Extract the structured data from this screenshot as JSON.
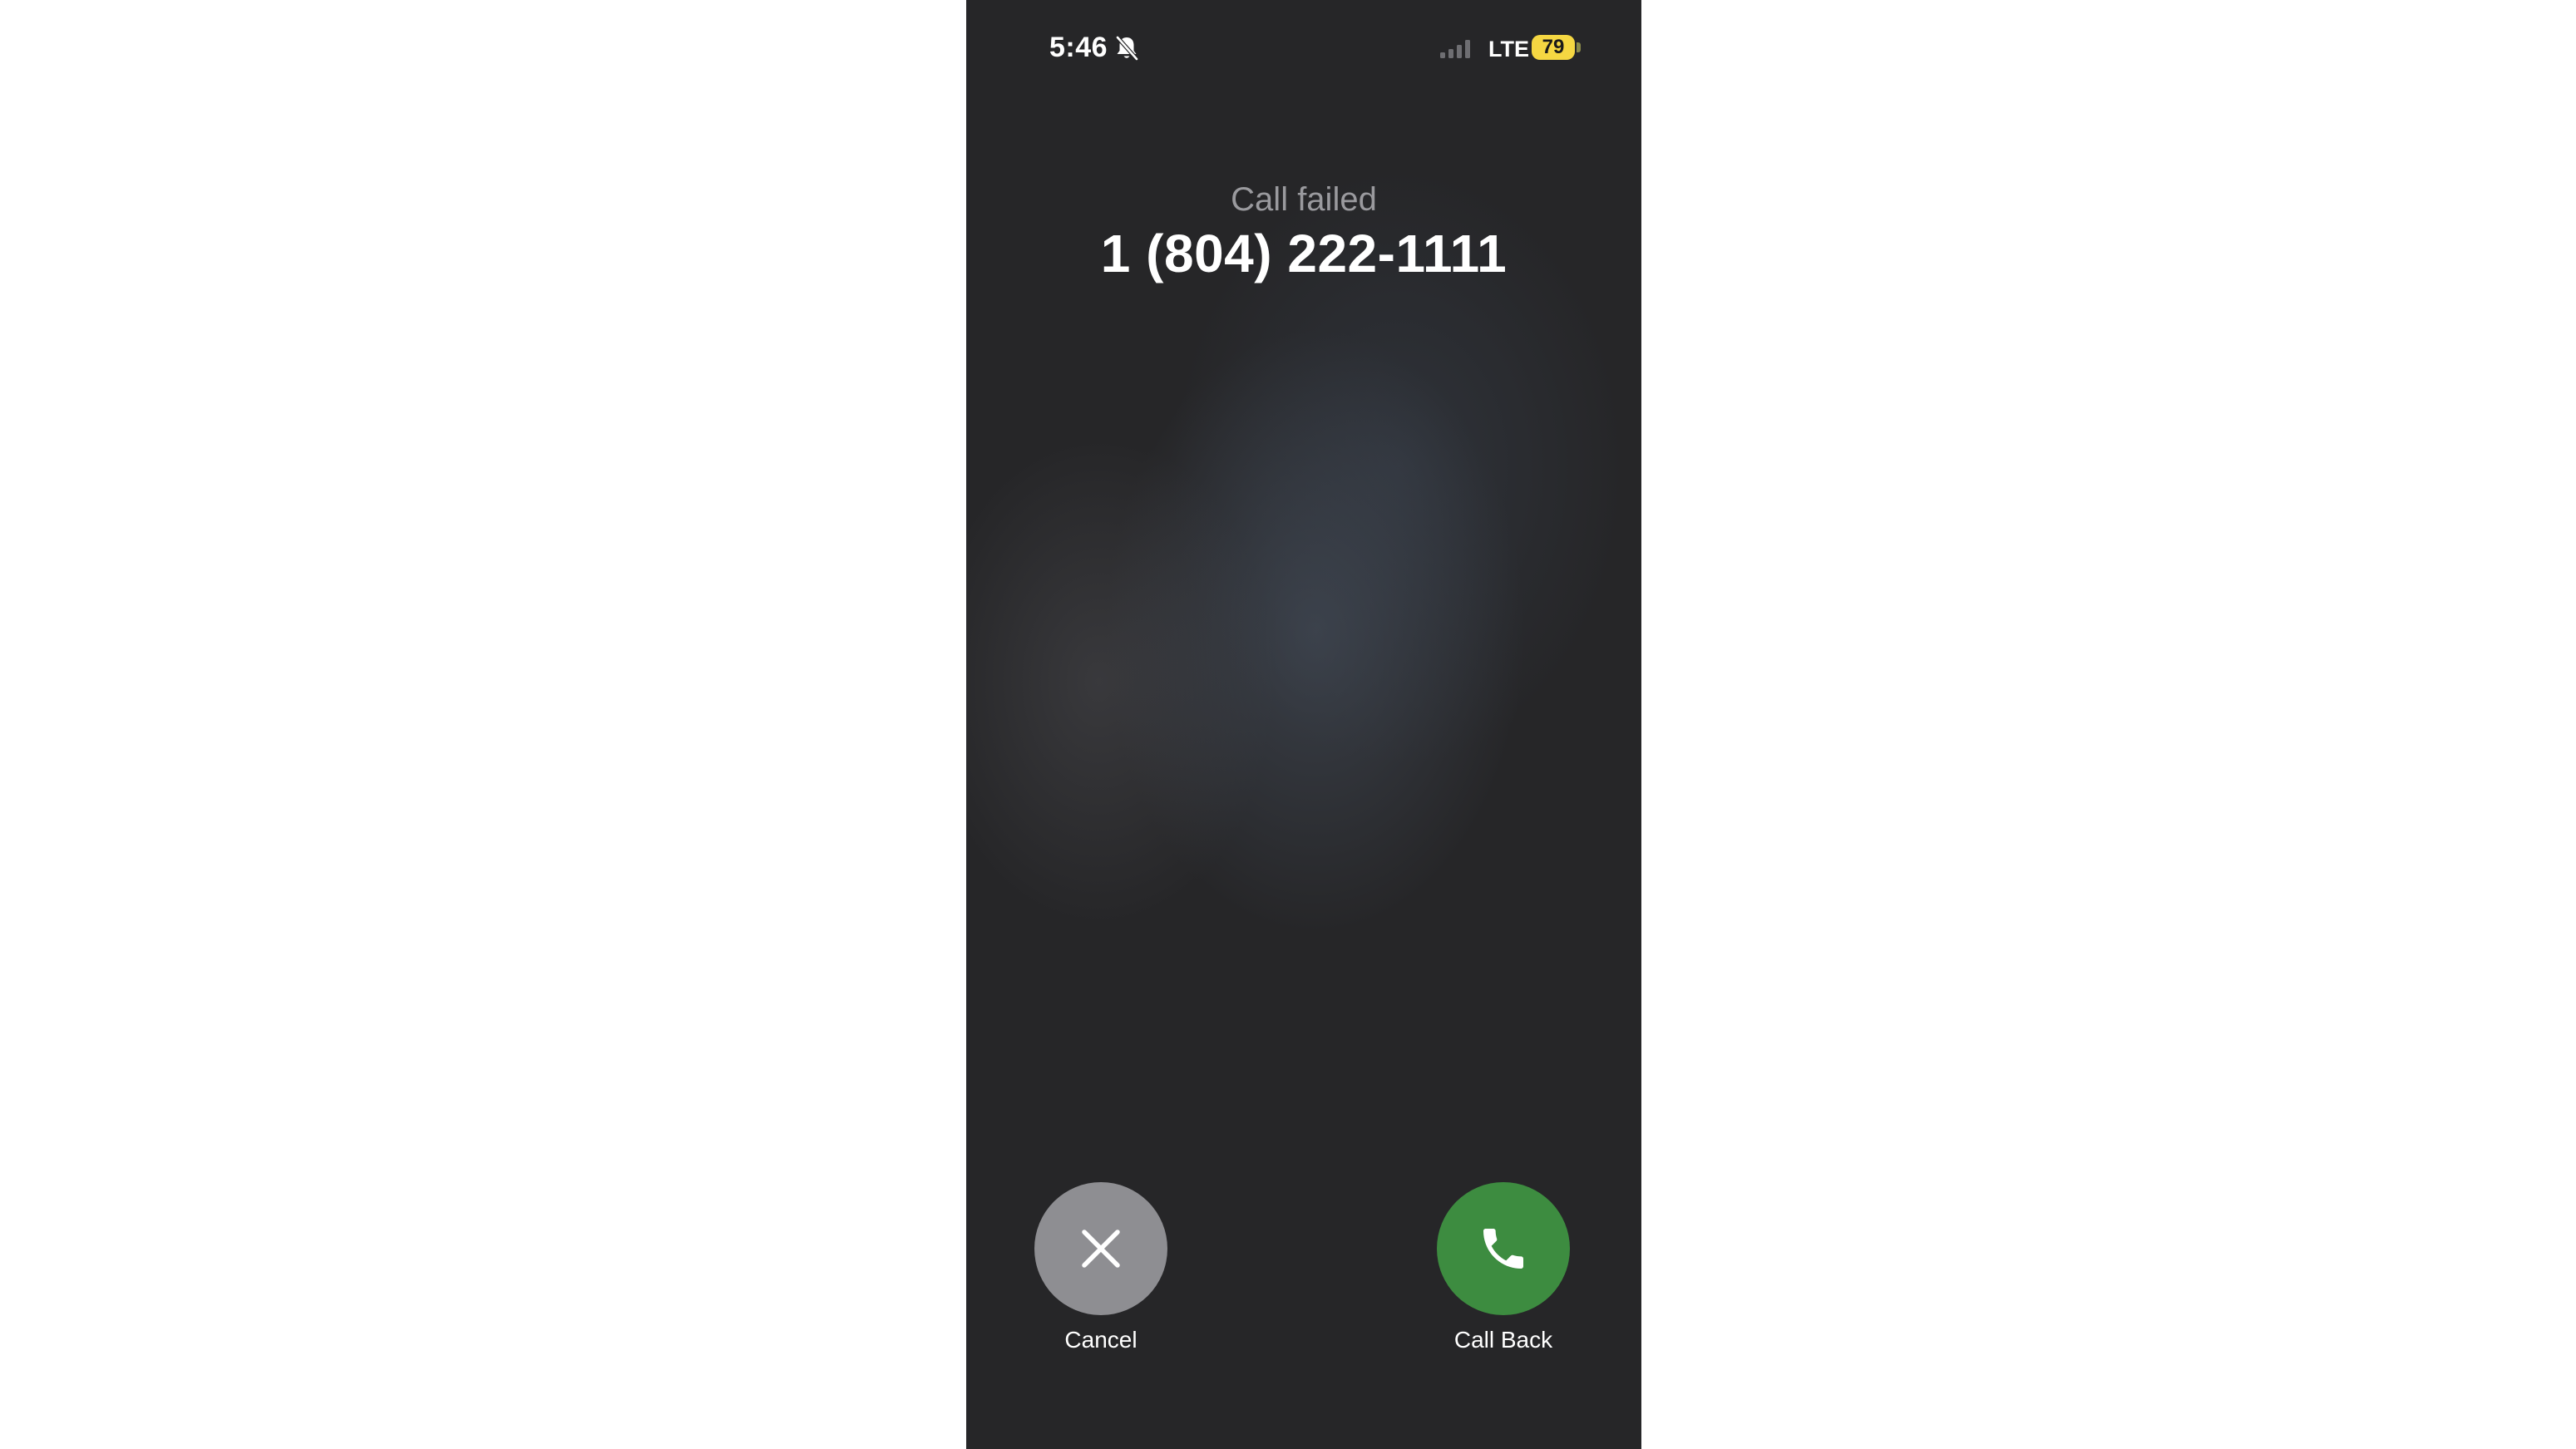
{
  "status_bar": {
    "time": "5:46",
    "silent_icon": "bell-slash-icon",
    "signal_icon": "cellular-signal-icon",
    "network": "LTE",
    "battery_level": "79",
    "battery_color": "#f5d742"
  },
  "call": {
    "status": "Call failed",
    "number": "1 (804) 222-1111"
  },
  "actions": {
    "cancel": {
      "label": "Cancel",
      "icon": "close-icon",
      "color": "#8e8e92"
    },
    "call_back": {
      "label": "Call Back",
      "icon": "phone-icon",
      "color": "#3d8c40"
    }
  }
}
